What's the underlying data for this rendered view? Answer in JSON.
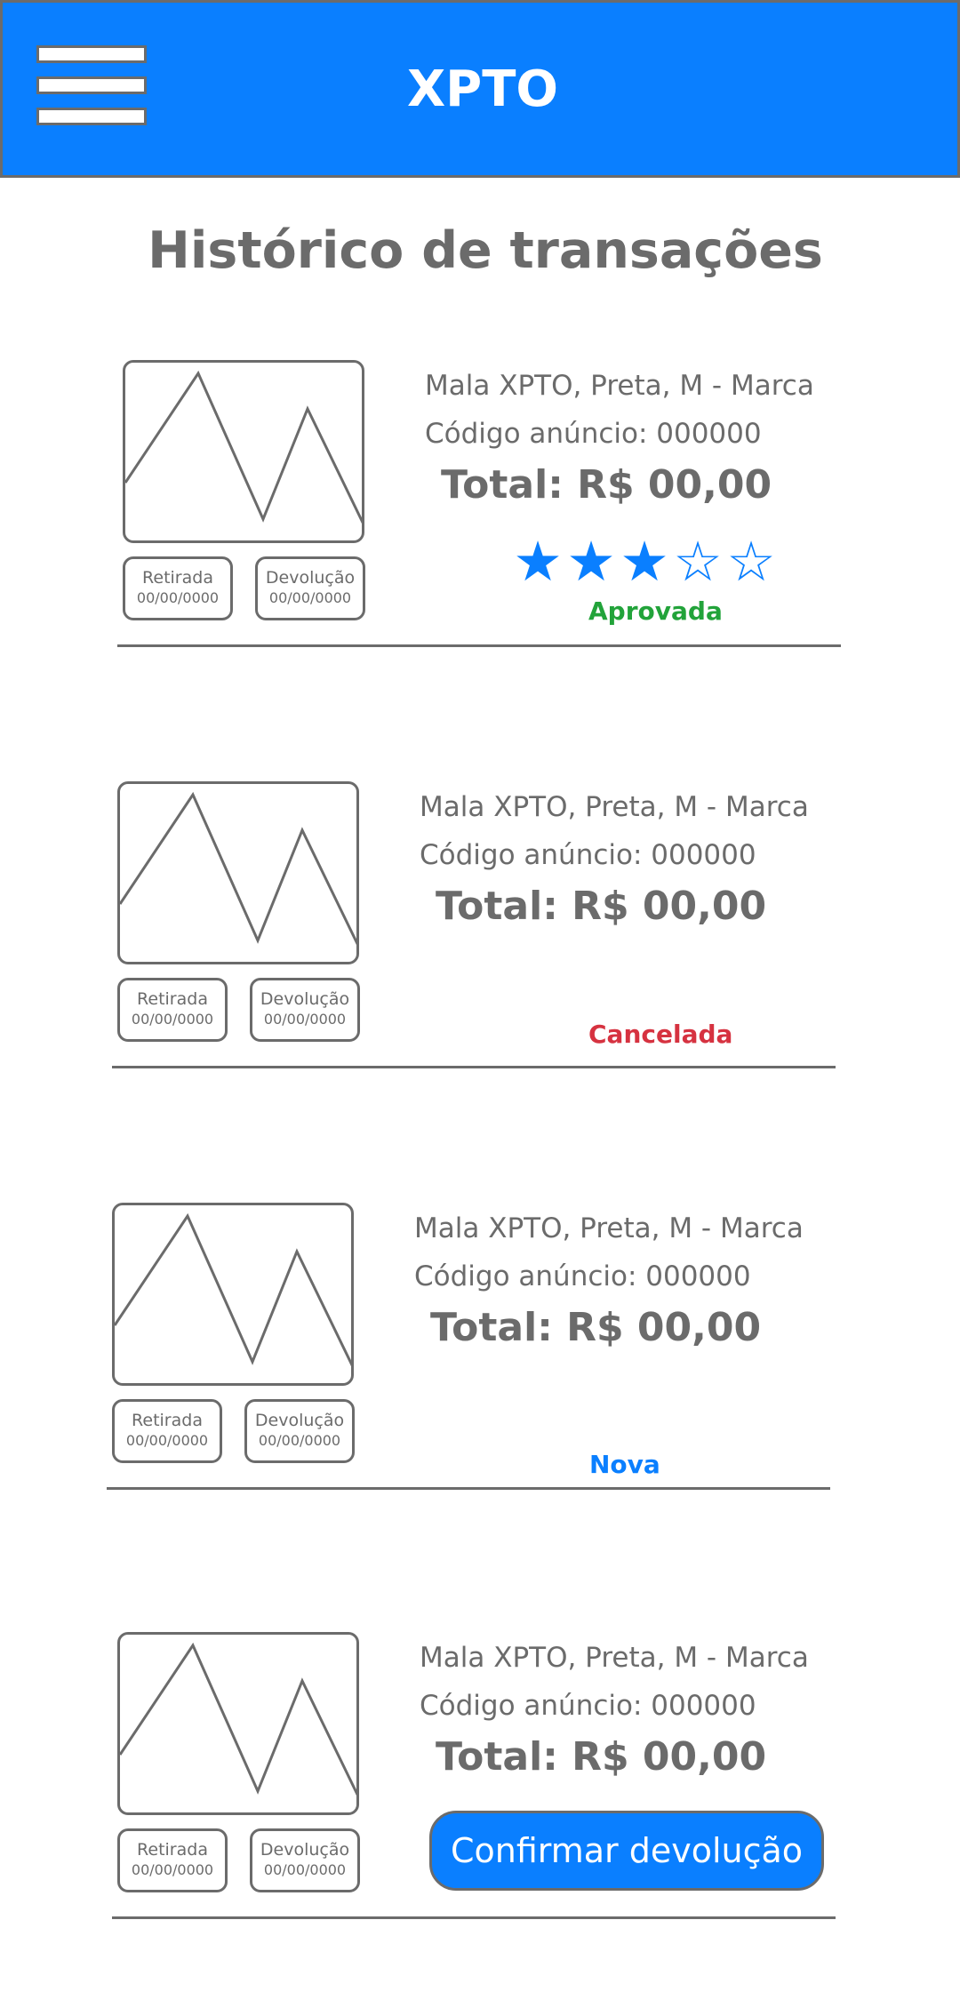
{
  "header": {
    "title": "XPTO",
    "menu_icon": "hamburger-menu-icon"
  },
  "page": {
    "title": "Histórico de transações"
  },
  "colors": {
    "primary": "#0a7fff",
    "approved": "#22a33a",
    "cancelled": "#d63240",
    "new": "#0a7fff",
    "text": "#6b6b6b"
  },
  "transactions": [
    {
      "name": "Mala XPTO, Preta, M - Marca",
      "code": "Código anúncio: 000000",
      "total": "Total: R$ 00,00",
      "pickup_label": "Retirada",
      "pickup_date": "00/00/0000",
      "return_label": "Devolução",
      "return_date": "00/00/0000",
      "rating": 3,
      "rating_max": 5,
      "status": "Aprovada"
    },
    {
      "name": "Mala XPTO, Preta, M - Marca",
      "code": "Código anúncio: 000000",
      "total": "Total: R$ 00,00",
      "pickup_label": "Retirada",
      "pickup_date": "00/00/0000",
      "return_label": "Devolução",
      "return_date": "00/00/0000",
      "status": "Cancelada"
    },
    {
      "name": "Mala XPTO, Preta, M - Marca",
      "code": "Código anúncio: 000000",
      "total": "Total: R$ 00,00",
      "pickup_label": "Retirada",
      "pickup_date": "00/00/0000",
      "return_label": "Devolução",
      "return_date": "00/00/0000",
      "status": "Nova"
    },
    {
      "name": "Mala XPTO, Preta, M - Marca",
      "code": "Código anúncio: 000000",
      "total": "Total: R$ 00,00",
      "pickup_label": "Retirada",
      "pickup_date": "00/00/0000",
      "return_label": "Devolução",
      "return_date": "00/00/0000",
      "action_label": "Confirmar devolução"
    }
  ]
}
